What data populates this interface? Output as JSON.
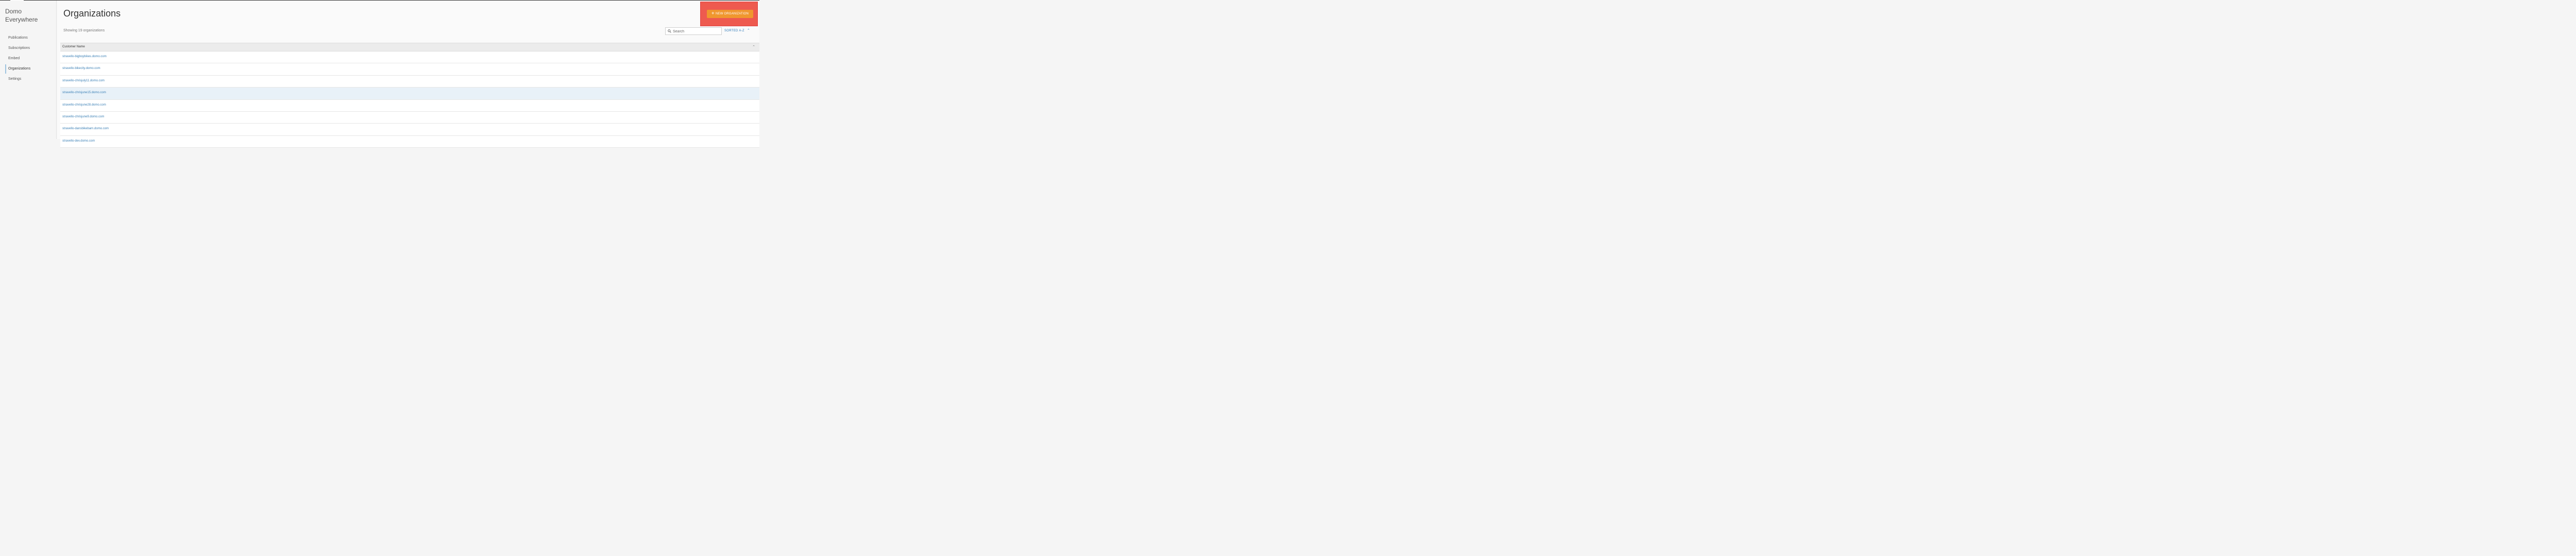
{
  "app": {
    "title_line1": "Domo",
    "title_line2": "Everywhere"
  },
  "sidebar": {
    "items": [
      {
        "label": "Publications",
        "active": false
      },
      {
        "label": "Subscriptions",
        "active": false
      },
      {
        "label": "Embed",
        "active": false
      },
      {
        "label": "Organizations",
        "active": true
      },
      {
        "label": "Settings",
        "active": false
      }
    ]
  },
  "page": {
    "title": "Organizations",
    "count_text": "Showing 19 organizations",
    "new_button_label": "NEW ORGANIZATION",
    "search_placeholder": "Search",
    "sort_label": "SORTED A-Z"
  },
  "table": {
    "column_header": "Customer Name",
    "rows": [
      "stravello-bigboybikes.domo.com",
      "stravello-bikecity.domo.com",
      "stravello-chrisjuly11.domo.com",
      "stravello-chrisjune15.domo.com",
      "stravello-chrisjune28.domo.com",
      "stravello-chrisjune9.domo.com",
      "stravello-dansbikebarn.domo.com",
      "stravello-dev.domo.com"
    ],
    "selected_row": 3
  },
  "colors": {
    "accent_orange": "#f0972e",
    "highlight_red": "#ee5a4f",
    "link_blue": "#3a7fb5"
  }
}
